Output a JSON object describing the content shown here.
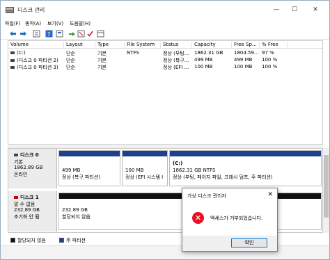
{
  "window": {
    "title": "디스크 관리"
  },
  "menu": [
    "파일(F)",
    "동작(A)",
    "보기(V)",
    "도움말(H)"
  ],
  "toolbar": [
    "back-icon",
    "forward-icon",
    "list-icon",
    "help-icon",
    "properties-icon",
    "connect-icon",
    "delete-icon",
    "check-icon",
    "view-icon"
  ],
  "volumes": {
    "columns": [
      "Volume",
      "Layout",
      "Type",
      "File System",
      "Status",
      "Capacity",
      "Free Sp...",
      "% Free"
    ],
    "rows": [
      [
        "(C:)",
        "단순",
        "기본",
        "NTFS",
        "정상 (부팅...",
        "1862.31 GB",
        "1804.59...",
        "97 %"
      ],
      [
        "(디스크 0 파티션 2)",
        "단순",
        "기본",
        "",
        "정상 (복구...",
        "499 MB",
        "499 MB",
        "100 %"
      ],
      [
        "(디스크 0 파티션 3)",
        "단순",
        "기본",
        "",
        "정상 (EFI ...",
        "100 MB",
        "100 MB",
        "100 %"
      ]
    ]
  },
  "disk0": {
    "name": "디스크 0",
    "type": "기본",
    "size": "1862.89 GB",
    "state": "온라인",
    "partitions": [
      {
        "title": "",
        "line1": "499 MB",
        "line2": "정상 (복구 파티션)"
      },
      {
        "title": "",
        "line1": "100 MB",
        "line2": "정상 (EFI 시스템 I"
      },
      {
        "title": "(C:)",
        "line1": "1862.31 GB NTFS",
        "line2": "정상 (부팅, 페이지 파일, 크래시 덤프, 주 파티션)"
      }
    ]
  },
  "disk1": {
    "name": "디스크 1",
    "type": "알 수 없음",
    "size": "232.89 GB",
    "state": "초기화 안 됨",
    "partition": {
      "line1": "232.89 GB",
      "line2": "할당되지 않음"
    }
  },
  "legend": [
    "할당되지 않음",
    "주 파티션"
  ],
  "dialog": {
    "title": "가상 디스크 관리자",
    "message": "액세스가 거부되었습니다.",
    "ok_label": "확인"
  },
  "colors": {
    "primary_bar": "#1f3f8f",
    "unallocated_bar": "#111111",
    "error": "#e81123"
  }
}
